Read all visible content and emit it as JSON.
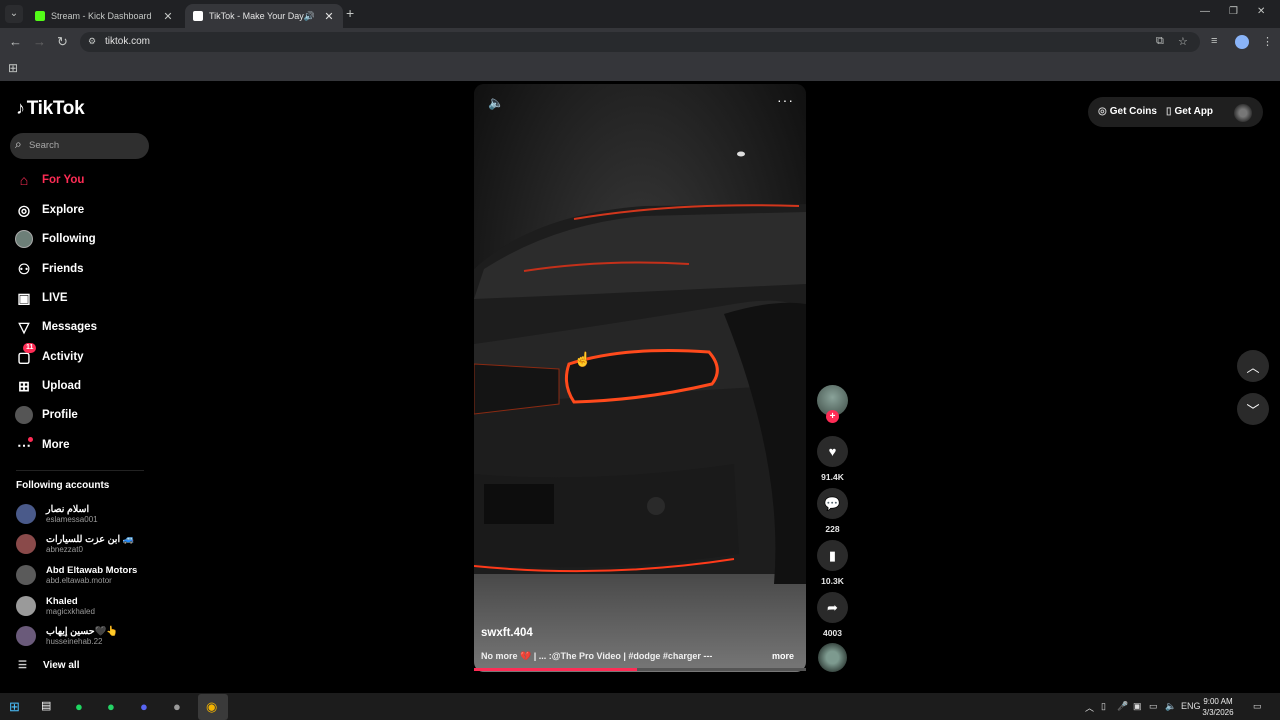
{
  "browser": {
    "tabs": [
      {
        "title": "Stream - Kick Dashboard",
        "favicon_color": "#53fc18"
      },
      {
        "title": "TikTok - Make Your Day",
        "favicon_color": "#ffffff"
      }
    ],
    "url": "tiktok.com"
  },
  "sidebar": {
    "logo": "TikTok",
    "search_placeholder": "Search",
    "nav": [
      {
        "label": "For You",
        "icon": "home-icon"
      },
      {
        "label": "Explore",
        "icon": "compass-icon"
      },
      {
        "label": "Following",
        "icon": "following-avatar-icon"
      },
      {
        "label": "Friends",
        "icon": "friends-icon"
      },
      {
        "label": "LIVE",
        "icon": "live-icon"
      },
      {
        "label": "Messages",
        "icon": "messages-icon"
      },
      {
        "label": "Activity",
        "icon": "activity-icon",
        "badge": "11"
      },
      {
        "label": "Upload",
        "icon": "upload-icon"
      },
      {
        "label": "Profile",
        "icon": "profile-icon"
      },
      {
        "label": "More",
        "icon": "more-icon"
      }
    ],
    "following_title": "Following accounts",
    "accounts": [
      {
        "name": "اسلام نصار",
        "handle": "eslamessa001",
        "color": "#4a5a8a"
      },
      {
        "name": "ابن عزت للسيارات 🚙",
        "handle": "abnezzat0",
        "color": "#8a4a4a"
      },
      {
        "name": "Abd Eltawab Motors",
        "handle": "abd.eltawab.motor",
        "color": "#5a5a5a"
      },
      {
        "name": "Khaled",
        "handle": "magicxkhaled",
        "color": "#9a9a9a"
      },
      {
        "name": "حسين إيهاب🖤👆",
        "handle": "husseinehab.22",
        "color": "#6a5a7a"
      }
    ],
    "view_all": "View all"
  },
  "video": {
    "username": "swxft.404",
    "caption": "No more 💔 | ... :@The Pro Video | #dodge #charger ---",
    "caption_more": "more",
    "progress": 0.49
  },
  "actions": {
    "likes": "91.4K",
    "comments": "228",
    "saves": "10.3K",
    "shares": "4003"
  },
  "topright": {
    "coins": "Get Coins",
    "app": "Get App"
  },
  "taskbar": {
    "lang": "ENG",
    "time": "9:00 AM",
    "date": "3/3/2026"
  }
}
